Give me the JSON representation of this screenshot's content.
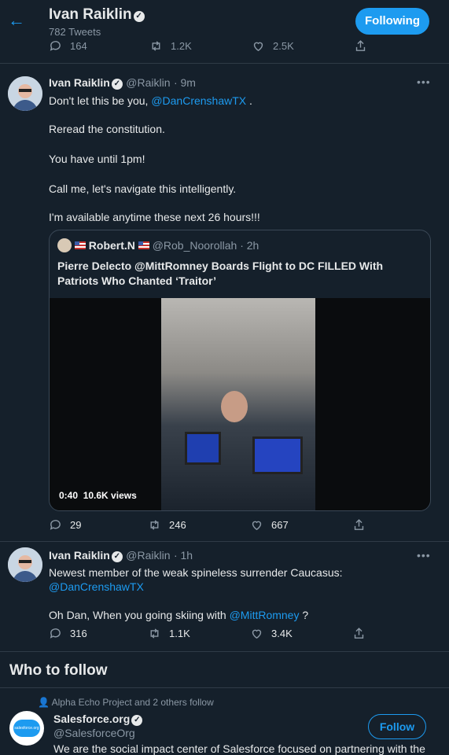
{
  "header": {
    "name": "Ivan Raiklin",
    "tweet_count": "782 Tweets",
    "follow_state": "Following"
  },
  "top_actions": {
    "replies": "164",
    "retweets": "1.2K",
    "likes": "2.5K"
  },
  "tweet1": {
    "name": "Ivan Raiklin",
    "handle": "@Raiklin",
    "time": "· 9m",
    "line1_prefix": "Don't let this be you, ",
    "line1_mention": "@DanCrenshawTX",
    "line1_suffix": " .",
    "line2": "Reread the constitution.",
    "line3": "You have until 1pm!",
    "line4": "Call me, let's navigate this intelligently.",
    "line5": "I'm available anytime these next 26 hours!!!",
    "quote": {
      "name": "Robert.N",
      "handle": "@Rob_Noorollah",
      "time": "· 2h",
      "text": "Pierre Delecto @MittRomney Boards Flight to DC FILLED With Patriots Who Chanted ‘Traitor’",
      "video_time": "0:40",
      "video_views": "10.6K views"
    },
    "actions": {
      "replies": "29",
      "retweets": "246",
      "likes": "667"
    }
  },
  "tweet2": {
    "name": "Ivan Raiklin",
    "handle": "@Raiklin",
    "time": "· 1h",
    "line1": "Newest member of the weak spineless surrender Caucasus:",
    "line1_mention": "@DanCrenshawTX",
    "line2_prefix": "Oh Dan, When you going skiing with ",
    "line2_mention": "@MittRomney",
    "line2_suffix": " ?",
    "actions": {
      "replies": "316",
      "retweets": "1.1K",
      "likes": "3.4K"
    }
  },
  "who_to_follow": {
    "title": "Who to follow",
    "social_context": "Alpha Echo Project and 2 others follow",
    "name": "Salesforce.org",
    "handle": "@SalesforceOrg",
    "bio": "We are the social impact center of Salesforce focused on partnering with the",
    "logo_text": "salesforce.org",
    "button": "Follow"
  },
  "colors": {
    "background": "#15202b",
    "accent": "#1d9bf0",
    "text": "#e7e9ea",
    "muted": "#8b98a5"
  }
}
